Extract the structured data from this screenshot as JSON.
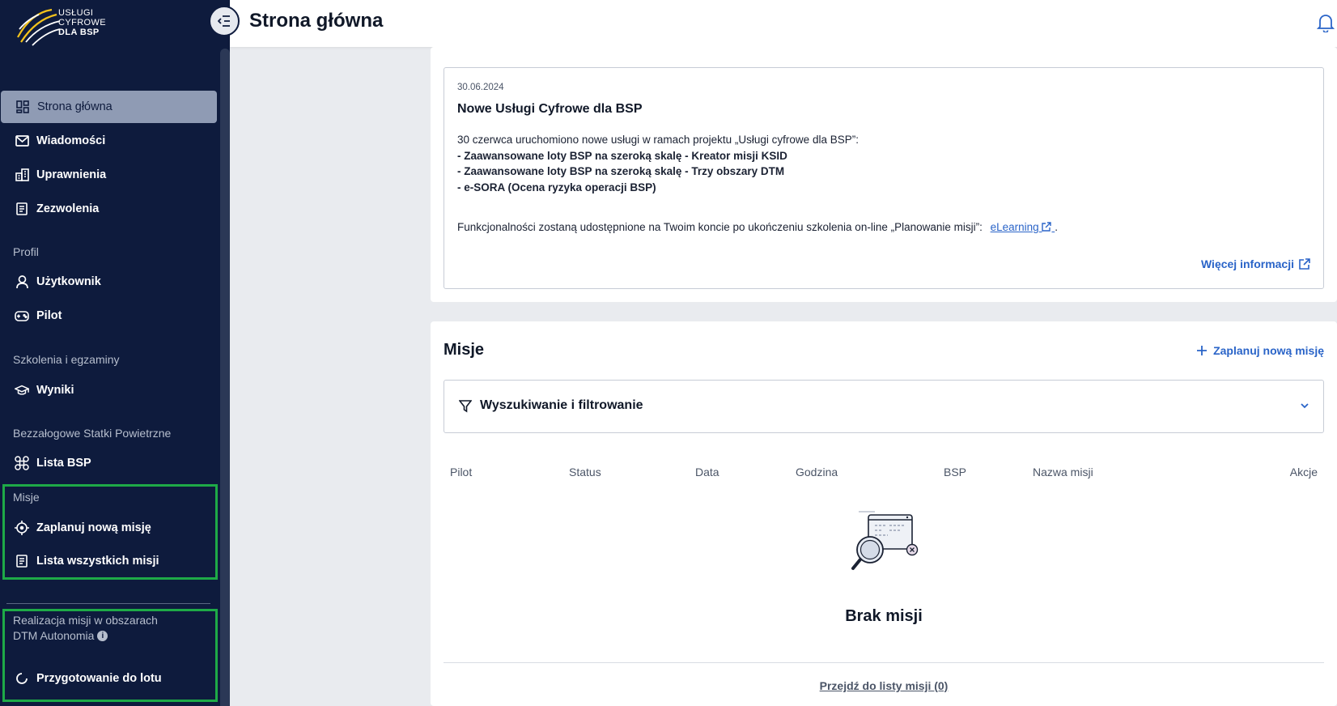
{
  "logo": {
    "line1": "USŁUGI",
    "line2": "CYFROWE",
    "line3": "DLA BSP"
  },
  "header": {
    "title": "Strona główna"
  },
  "sidebar": {
    "main_items": [
      {
        "label": "Strona główna",
        "icon": "dashboard-icon",
        "active": true
      },
      {
        "label": "Wiadomości",
        "icon": "mail-icon"
      },
      {
        "label": "Uprawnienia",
        "icon": "buildings-icon"
      },
      {
        "label": "Zezwolenia",
        "icon": "document-icon"
      }
    ],
    "profile": {
      "label": "Profil",
      "items": [
        {
          "label": "Użytkownik",
          "icon": "user-icon"
        },
        {
          "label": "Pilot",
          "icon": "gamepad-icon"
        }
      ]
    },
    "training": {
      "label": "Szkolenia i egzaminy",
      "items": [
        {
          "label": "Wyniki",
          "icon": "graduation-cap-icon"
        }
      ]
    },
    "bsp": {
      "label": "Bezzałogowe Statki Powietrzne",
      "items": [
        {
          "label": "Lista BSP",
          "icon": "drone-icon"
        }
      ]
    },
    "missions": {
      "label": "Misje",
      "items": [
        {
          "label": "Zaplanuj nową misję",
          "icon": "crosshair-icon"
        },
        {
          "label": "Lista wszystkich misji",
          "icon": "list-document-icon"
        }
      ]
    },
    "dtm": {
      "label_line1": "Realizacja misji w obszarach",
      "label_line2": "DTM Autonomia",
      "items": [
        {
          "label": "Przygotowanie do lotu",
          "icon": "loading-icon"
        }
      ]
    }
  },
  "news": {
    "date": "30.06.2024",
    "title": "Nowe Usługi Cyfrowe dla BSP",
    "intro": "30 czerwca uruchomiono nowe usługi w ramach projektu „Usługi cyfrowe dla BSP”:",
    "bullets": [
      "- Zaawansowane loty BSP na szeroką skalę - Kreator misji KSID",
      "- Zaawansowane loty BSP na szeroką skalę - Trzy obszary DTM",
      "- e-SORA (Ocena ryzyka operacji BSP)"
    ],
    "footer_text": "Funkcjonalności zostaną udostępnione na Twoim koncie po ukończeniu szkolenia on-line „Planowanie misji”:",
    "footer_link": "eLearning",
    "footer_end": ".",
    "more_label": "Więcej informacji"
  },
  "missions": {
    "title": "Misje",
    "plan_label": "Zaplanuj nową misję",
    "filter_label": "Wyszukiwanie i filtrowanie",
    "columns": [
      "Pilot",
      "Status",
      "Data",
      "Godzina",
      "BSP",
      "Nazwa misji",
      "Akcje"
    ],
    "empty_text": "Brak misji",
    "list_link": "Przejdź do listy misji (0)"
  },
  "colors": {
    "sidebar_bg": "#0e1b3d",
    "accent": "#2a64c8",
    "highlight": "#1eaa47",
    "active_item": "#8f9bb4"
  }
}
